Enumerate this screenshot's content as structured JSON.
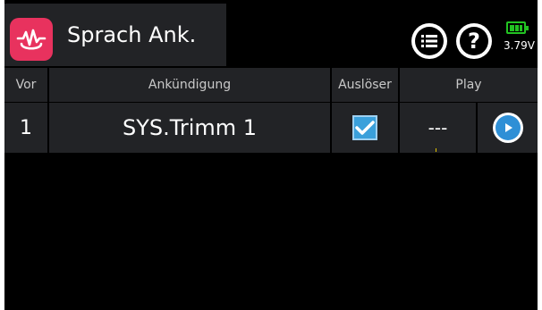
{
  "header": {
    "title": "Sprach Ank.",
    "app_icon": "voice-announcement-icon",
    "menu_icon": "list-icon",
    "help_icon": "help-icon",
    "help_glyph": "?",
    "battery_voltage": "3.79V",
    "battery_level": 0.75,
    "battery_color": "#22c322"
  },
  "table": {
    "columns": [
      "Vor",
      "Ankündigung",
      "Auslöser",
      "Play"
    ],
    "rows": [
      {
        "index": "1",
        "announcement": "SYS.Trimm 1",
        "trigger_checked": true,
        "play_value": "---"
      }
    ]
  },
  "colors": {
    "accent": "#e8325e",
    "panel": "#222326",
    "checkbox": "#3aa0db",
    "play": "#2e8fd6"
  }
}
